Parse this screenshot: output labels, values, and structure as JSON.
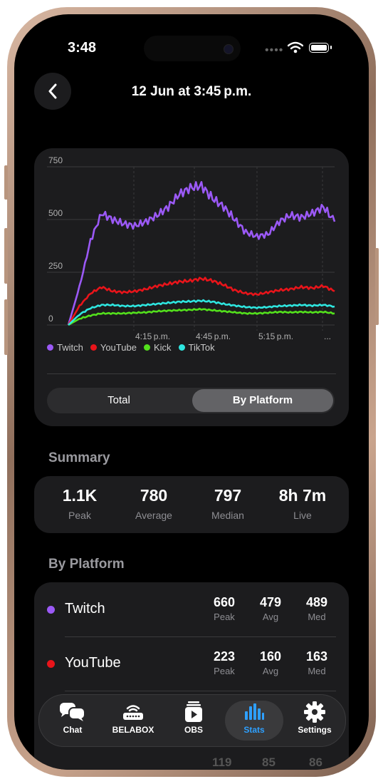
{
  "status": {
    "time": "3:48"
  },
  "header": {
    "title": "12 Jun at 3:45 p.m."
  },
  "chart_data": {
    "type": "line",
    "y_ticks": [
      "750",
      "500",
      "250",
      "0"
    ],
    "ylim": [
      0,
      750
    ],
    "x_ticks": [
      "4:15 p.m.",
      "4:45 p.m.",
      "5:15 p.m.",
      "..."
    ],
    "x": [
      "3:45",
      "3:50",
      "3:55",
      "4:00",
      "4:05",
      "4:10",
      "4:15",
      "4:20",
      "4:25",
      "4:30",
      "4:35",
      "4:40",
      "4:45",
      "4:50",
      "4:55",
      "5:00",
      "5:05",
      "5:10",
      "5:15",
      "5:20",
      "5:25",
      "5:30",
      "5:35",
      "5:40",
      "5:45"
    ],
    "series": [
      {
        "name": "Twitch",
        "color": "#9b59f6",
        "values": [
          0,
          180,
          400,
          530,
          500,
          480,
          470,
          490,
          520,
          560,
          620,
          650,
          660,
          600,
          560,
          500,
          440,
          420,
          430,
          490,
          520,
          510,
          530,
          560,
          490
        ]
      },
      {
        "name": "YouTube",
        "color": "#e8141a",
        "values": [
          0,
          90,
          150,
          180,
          160,
          155,
          160,
          170,
          185,
          195,
          205,
          210,
          220,
          210,
          190,
          165,
          150,
          145,
          155,
          165,
          170,
          180,
          175,
          185,
          160
        ]
      },
      {
        "name": "Kick",
        "color": "#53e01c",
        "values": [
          0,
          30,
          45,
          55,
          55,
          55,
          58,
          60,
          65,
          68,
          70,
          72,
          75,
          70,
          65,
          60,
          55,
          55,
          58,
          62,
          60,
          62,
          60,
          62,
          55
        ]
      },
      {
        "name": "TikTok",
        "color": "#2ee6e0",
        "values": [
          0,
          50,
          80,
          95,
          95,
          90,
          90,
          95,
          100,
          105,
          110,
          112,
          115,
          110,
          100,
          92,
          85,
          82,
          85,
          90,
          92,
          95,
          92,
          95,
          88
        ]
      }
    ]
  },
  "segmented": {
    "option1": "Total",
    "option2": "By Platform"
  },
  "summary": {
    "heading": "Summary",
    "items": [
      {
        "value": "1.1K",
        "label": "Peak"
      },
      {
        "value": "780",
        "label": "Average"
      },
      {
        "value": "797",
        "label": "Median"
      },
      {
        "value": "8h 7m",
        "label": "Live"
      }
    ]
  },
  "by_platform": {
    "heading": "By Platform",
    "rows": [
      {
        "name": "Twitch",
        "color": "#9b59f6",
        "peak": "660",
        "avg": "479",
        "med": "489",
        "peak_label": "Peak",
        "avg_label": "Avg",
        "med_label": "Med"
      },
      {
        "name": "YouTube",
        "color": "#e8141a",
        "peak": "223",
        "avg": "160",
        "med": "163",
        "peak_label": "Peak",
        "avg_label": "Avg",
        "med_label": "Med"
      }
    ],
    "hidden_row_values": [
      "119",
      "85",
      "86"
    ]
  },
  "tabbar": {
    "items": [
      {
        "label": "Chat",
        "icon": "chat-bubbles-icon"
      },
      {
        "label": "BELABOX",
        "icon": "router-icon"
      },
      {
        "label": "OBS",
        "icon": "obs-play-icon"
      },
      {
        "label": "Stats",
        "icon": "bar-chart-icon"
      },
      {
        "label": "Settings",
        "icon": "gear-icon"
      }
    ],
    "active": "Stats"
  }
}
